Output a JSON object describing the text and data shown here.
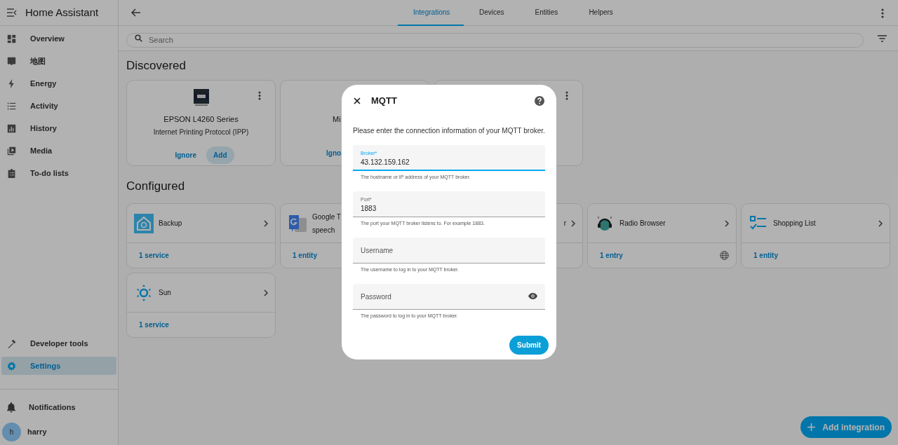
{
  "sidebar": {
    "title": "Home Assistant",
    "items": [
      {
        "label": "Overview",
        "selected": false
      },
      {
        "label": "地图",
        "selected": false
      },
      {
        "label": "Energy",
        "selected": false
      },
      {
        "label": "Activity",
        "selected": false
      },
      {
        "label": "History",
        "selected": false
      },
      {
        "label": "Media",
        "selected": false
      },
      {
        "label": "To-do lists",
        "selected": false
      }
    ],
    "bottom_items": [
      {
        "label": "Developer tools",
        "selected": false
      },
      {
        "label": "Settings",
        "selected": true
      }
    ],
    "notifications": "Notifications",
    "user": {
      "initial": "h",
      "name": "harry"
    }
  },
  "tabs": [
    {
      "label": "Integrations",
      "selected": true
    },
    {
      "label": "Devices",
      "selected": false
    },
    {
      "label": "Entities",
      "selected": false
    },
    {
      "label": "Helpers",
      "selected": false
    }
  ],
  "search": {
    "placeholder": "Search"
  },
  "discovered": {
    "heading": "Discovered",
    "cards": [
      {
        "kind": "full",
        "title": "EPSON L4260 Series",
        "subtitle": "Internet Printing Protocol (IPP)",
        "buttons": [
          {
            "label": "Ignore",
            "kind": "text"
          },
          {
            "label": "Add",
            "kind": "tonal"
          }
        ]
      },
      {
        "kind": "partial",
        "title": "Mi",
        "buttons": [
          {
            "label": "Igno",
            "kind": "text"
          }
        ]
      },
      {
        "kind": "menu_only"
      }
    ]
  },
  "configured": {
    "heading": "Configured",
    "cards": [
      {
        "kind": "full",
        "title_lines": [
          "Backup"
        ],
        "footer": "1 service",
        "cloud": false
      },
      {
        "kind": "full",
        "title_lines": [
          "Google T",
          "speech"
        ],
        "footer": "1 entity"
      },
      {
        "kind": "partial",
        "title_lines": [
          "r"
        ]
      },
      {
        "kind": "full",
        "title_lines": [
          "Radio Browser"
        ],
        "footer": "1 entry",
        "cloud": true
      },
      {
        "kind": "full",
        "title_lines": [
          "Shopping List"
        ],
        "footer": "1 entity",
        "cloud": false
      },
      {
        "kind": "full",
        "title_lines": [
          "Sun"
        ],
        "footer": "1 service",
        "cloud": false
      }
    ]
  },
  "add_integration": "Add integration",
  "dialog": {
    "title": "MQTT",
    "description": "Please enter the connection information of your MQTT broker.",
    "fields": [
      {
        "kind": "text",
        "label": "Broker*",
        "value": "43.132.159.162",
        "helper": "The hostname or IP address of your MQTT broker.",
        "focused": true
      },
      {
        "kind": "text",
        "label": "Port*",
        "value": "1883",
        "helper": "The port your MQTT broker listens to. For example 1883.",
        "focused": false
      },
      {
        "kind": "text",
        "label": "Username",
        "helper": "The username to log in to your MQTT broker.",
        "focused": false
      },
      {
        "kind": "password",
        "label": "Password",
        "helper": "The password to log in to your MQTT broker.",
        "focused": false
      }
    ],
    "submit": "Submit"
  }
}
